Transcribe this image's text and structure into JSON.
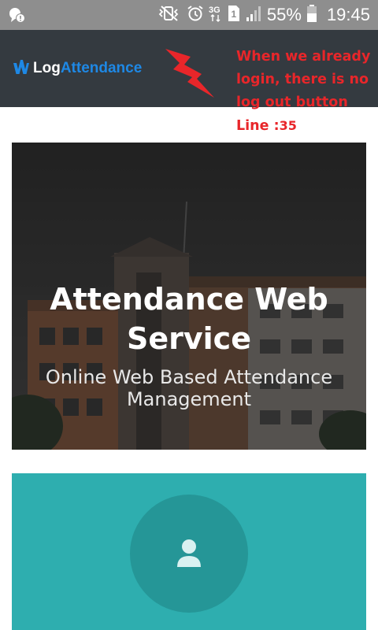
{
  "status_bar": {
    "battery_percent": "55%",
    "time": "19:45",
    "network_type": "3G",
    "sim_slot": "1",
    "icons": [
      "notification-icon",
      "mute-vibrate-icon",
      "alarm-icon",
      "network-3g-icon",
      "sim-icon",
      "signal-icon",
      "battery-icon"
    ]
  },
  "header": {
    "logo_part1": "Log",
    "logo_part2": "Attendance",
    "colors": {
      "background": "#343a40",
      "logo_accent": "#1e88e5"
    }
  },
  "annotation": {
    "lines": [
      "When we already",
      "login, there is no",
      "log out button"
    ],
    "line_label": "Line :",
    "line_number": "35",
    "color": "#e8262a"
  },
  "hero": {
    "title": "Attendance Web Service",
    "subtitle": "Online Web Based Attendance Management"
  },
  "profile_card": {
    "icon": "user-icon",
    "colors": {
      "background": "#2eaeaf",
      "circle": "#259697"
    }
  }
}
